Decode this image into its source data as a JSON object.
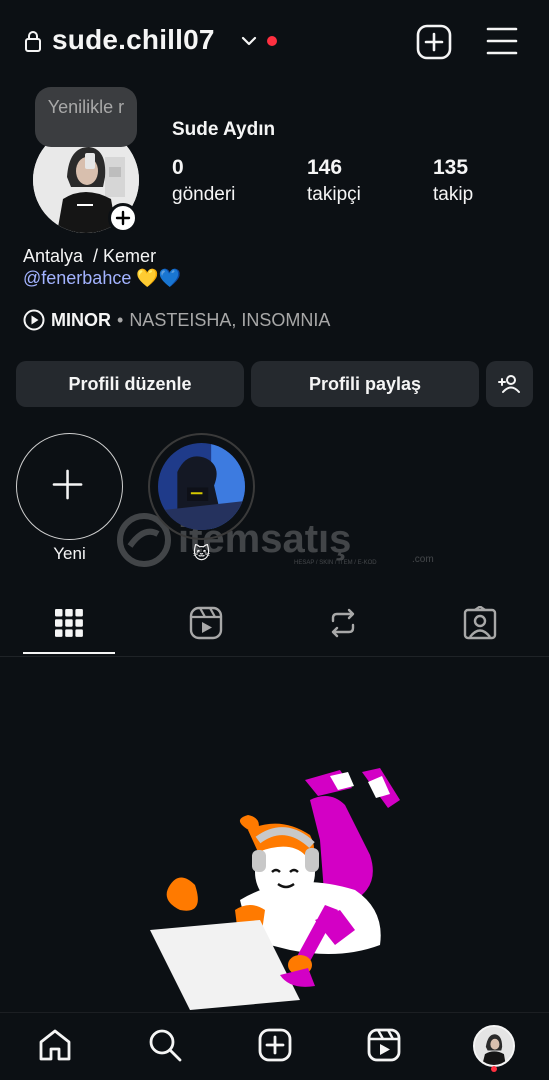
{
  "header": {
    "username": "sude.chill07",
    "icons": [
      "lock-icon",
      "chevron-down-icon",
      "create-post-icon",
      "menu-icon"
    ],
    "notification_color": "#ff3040"
  },
  "profile": {
    "note": "Yenilikle r",
    "display_name": "Sude Aydın",
    "stats": [
      {
        "num": "0",
        "label": "gönderi"
      },
      {
        "num": "146",
        "label": "takipçi"
      },
      {
        "num": "135",
        "label": "takip"
      }
    ],
    "bio_line": "Antalya  / Kemer",
    "bio_link": "@fenerbahce 💛💙",
    "music": {
      "artist": "MINOR",
      "separator": "•",
      "song": "NASTEISHA, INSOMNIA"
    }
  },
  "buttons": {
    "edit": "Profili düzenle",
    "share": "Profili paylaş"
  },
  "highlights": [
    {
      "label": "Yeni"
    },
    {
      "label": "🐱"
    }
  ],
  "tabs": [
    {
      "name": "tab-posts",
      "icon": "grid-icon",
      "active": true
    },
    {
      "name": "tab-reels",
      "icon": "reels-icon",
      "active": false
    },
    {
      "name": "tab-reposts",
      "icon": "repost-icon",
      "active": false
    },
    {
      "name": "tab-tagged",
      "icon": "tagged-icon",
      "active": false
    }
  ],
  "watermark": {
    "text": "itemsatış",
    "sub": "HESAP / SKIN / ITEM / E-KOD",
    "suffix": ".com"
  },
  "bottom_nav": [
    "home-icon",
    "search-icon",
    "create-icon",
    "reels-icon",
    "profile-avatar"
  ],
  "colors": {
    "background": "#0c1014",
    "button": "#25292e",
    "link": "#a3b3ff",
    "accent_orange": "#ff7a00",
    "accent_magenta": "#d300c5"
  }
}
